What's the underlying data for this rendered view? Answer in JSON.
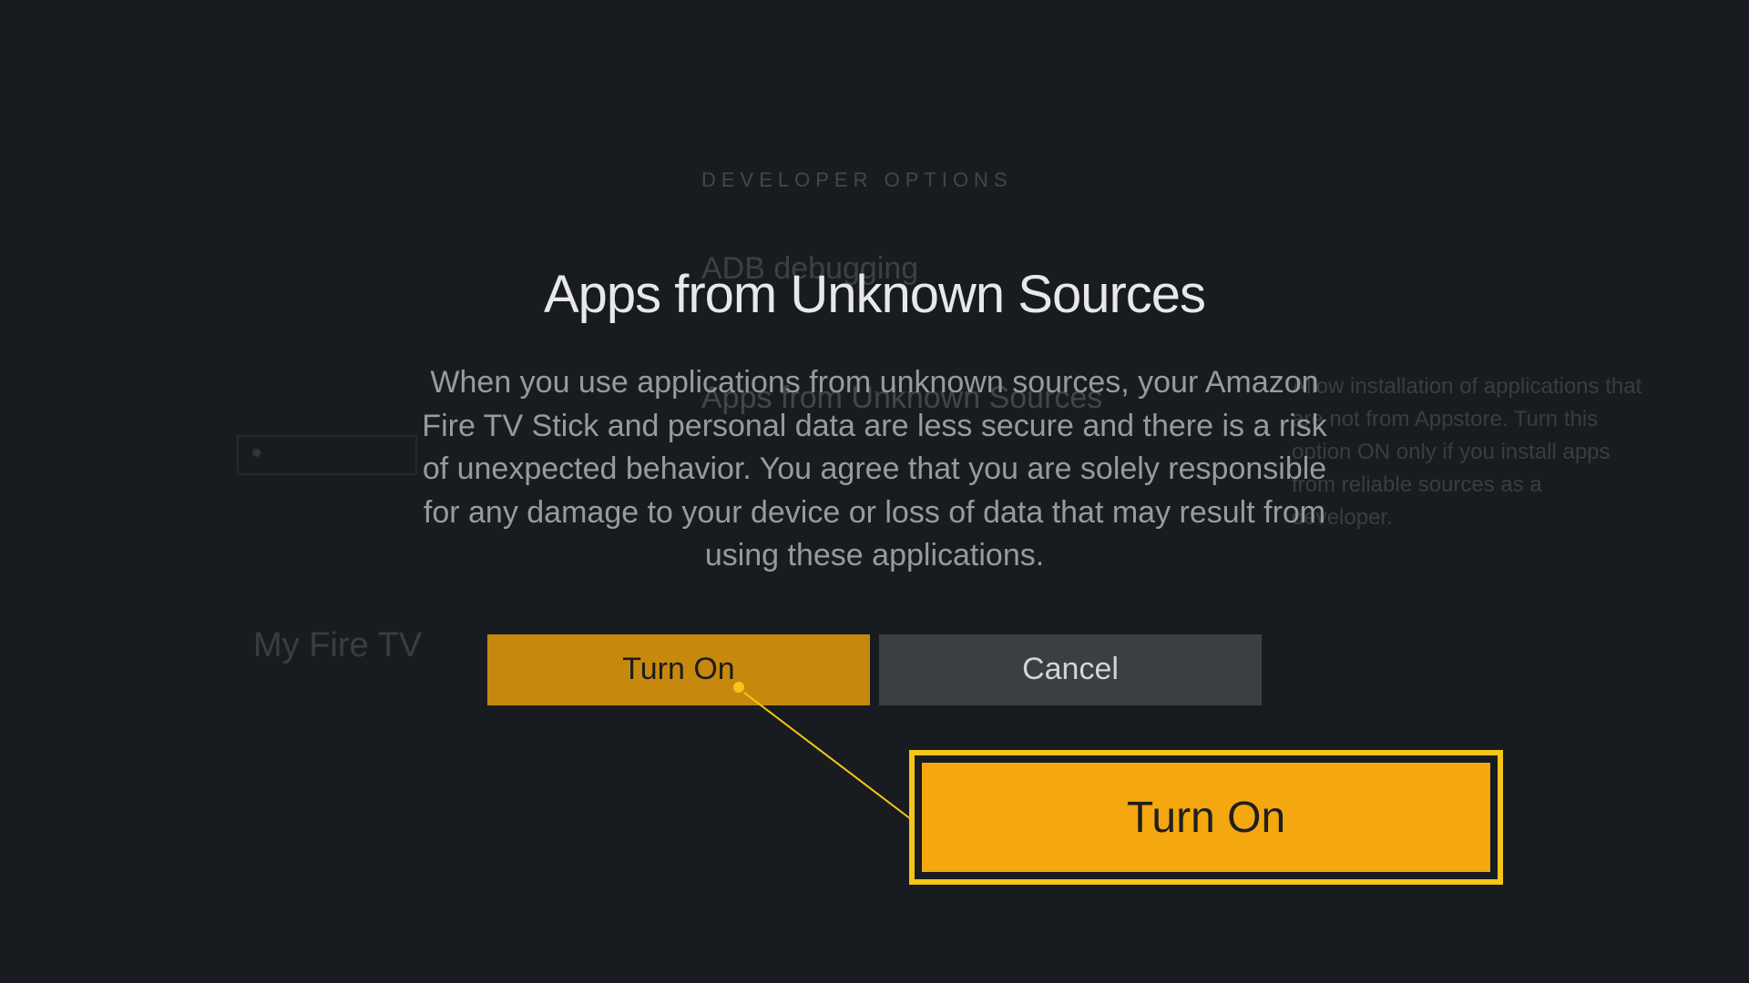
{
  "background": {
    "header": "DEVELOPER OPTIONS",
    "item_adb": "ADB debugging",
    "item_unknown": "Apps from Unknown Sources",
    "sidebar_label": "My Fire TV",
    "help_text": "Allow installation of applications that are not from Appstore. Turn this option ON only if you install apps from reliable sources as a developer."
  },
  "dialog": {
    "title": "Apps from Unknown Sources",
    "body": "When you use applications from unknown sources, your Amazon Fire TV Stick and personal data are less secure and there is a risk of unexpected behavior. You agree that you are solely responsible for any damage to your device or loss of data that may result from using these applications.",
    "turn_on_label": "Turn On",
    "cancel_label": "Cancel"
  },
  "callout": {
    "label": "Turn On"
  }
}
